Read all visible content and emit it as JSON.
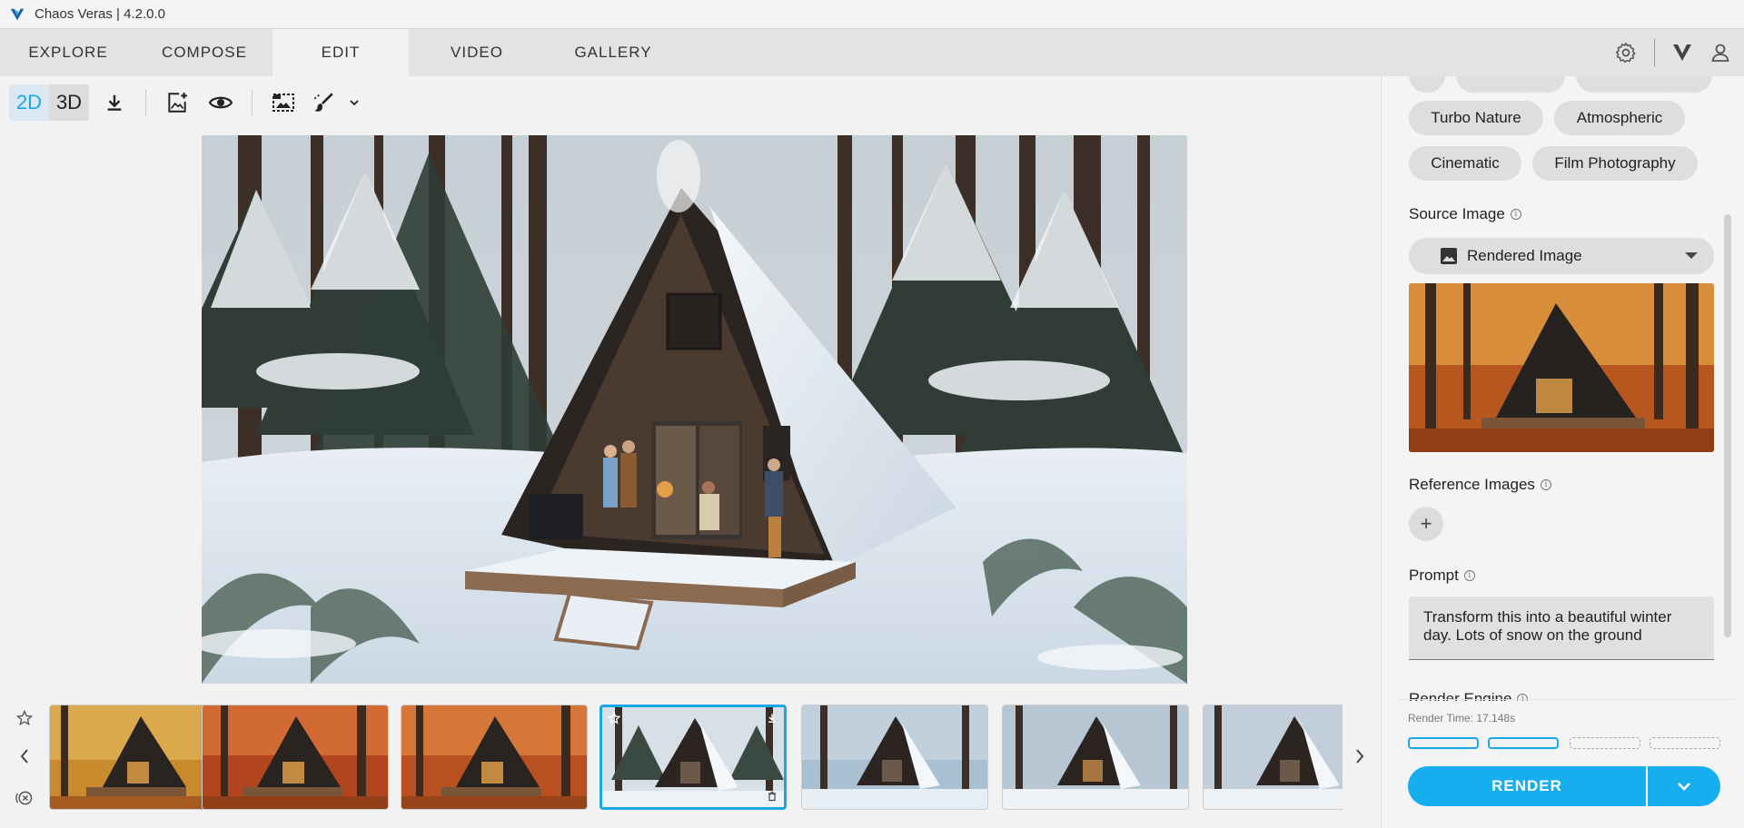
{
  "app": {
    "title": "Chaos Veras | 4.2.0.0",
    "accent": "#1aa7e8"
  },
  "nav": {
    "tabs": [
      {
        "label": "EXPLORE",
        "active": false
      },
      {
        "label": "COMPOSE",
        "active": false
      },
      {
        "label": "EDIT",
        "active": true
      },
      {
        "label": "VIDEO",
        "active": false
      },
      {
        "label": "GALLERY",
        "active": false
      }
    ],
    "icons": [
      "settings-icon",
      "veras-logo-icon",
      "user-icon"
    ]
  },
  "toolbar": {
    "mode_2d": "2D",
    "mode_3d": "3D",
    "active_mode": "2D",
    "icons": [
      "download-icon",
      "add-image-icon",
      "eye-icon",
      "image-region-icon",
      "brush-icon",
      "chevron-down-icon"
    ]
  },
  "canvas": {
    "image_desc_icon": "winter-cabin-render"
  },
  "filmstrip": {
    "side_icons": [
      "star-icon",
      "chevron-left-icon",
      "clear-icon"
    ],
    "thumbnails": [
      {
        "variant": "autumn-golden",
        "selected": false
      },
      {
        "variant": "autumn-red",
        "selected": false
      },
      {
        "variant": "autumn-red",
        "selected": false
      },
      {
        "variant": "winter",
        "selected": true
      },
      {
        "variant": "winter",
        "selected": false
      },
      {
        "variant": "winter",
        "selected": false
      },
      {
        "variant": "winter",
        "selected": false
      }
    ],
    "next_icon": "chevron-right-icon"
  },
  "panel": {
    "style_chips": [
      "Turbo Nature",
      "Atmospheric",
      "Cinematic",
      "Film Photography"
    ],
    "source_image_label": "Source Image",
    "source_dropdown_value": "Rendered Image",
    "reference_images_label": "Reference Images",
    "add_reference": "+",
    "prompt_label": "Prompt",
    "prompt_value": "Transform this into a beautiful winter day.  Lots of snow on the ground",
    "render_engine_label": "Render Engine",
    "render_time": "Render Time: 17.148s",
    "render_button": "RENDER"
  }
}
